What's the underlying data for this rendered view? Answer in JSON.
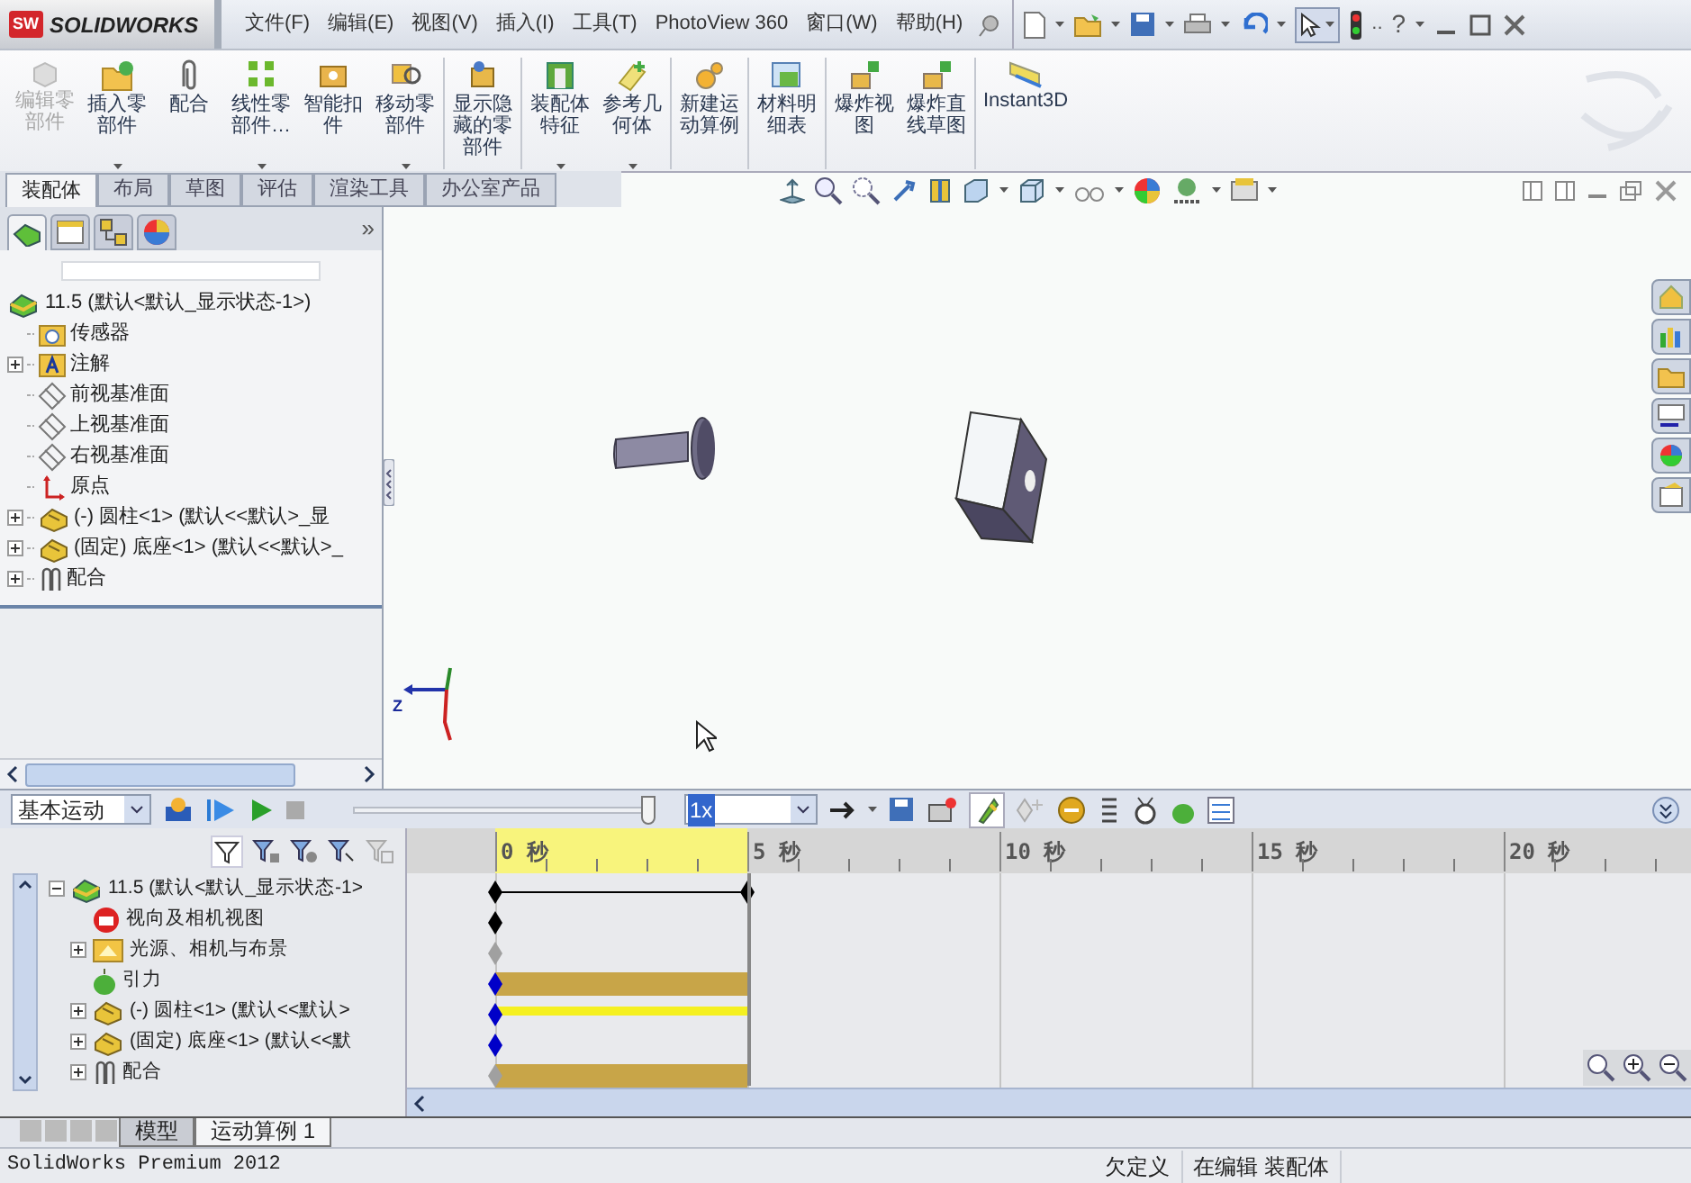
{
  "title_bar": {
    "logo_badge": "SW",
    "logo": "SOLIDWORKS",
    "menu": [
      "文件(F)",
      "编辑(E)",
      "视图(V)",
      "插入(I)",
      "工具(T)",
      "PhotoView 360",
      "窗口(W)",
      "帮助(H)"
    ],
    "more_glyph": "..",
    "help_glyph": "?"
  },
  "ribbon": {
    "commands": [
      {
        "label": "编辑零部件",
        "kind": "edit",
        "disabled": true,
        "dropdown": false,
        "separator_before": false
      },
      {
        "label": "插入零部件",
        "kind": "insert",
        "disabled": false,
        "dropdown": true,
        "separator_before": false
      },
      {
        "label": "配合",
        "kind": "mate",
        "disabled": false,
        "dropdown": false,
        "separator_before": false
      },
      {
        "label": "线性零部件…",
        "kind": "pattern",
        "disabled": false,
        "dropdown": true,
        "separator_before": false
      },
      {
        "label": "智能扣件",
        "kind": "fastener",
        "disabled": false,
        "dropdown": false,
        "separator_before": false
      },
      {
        "label": "移动零部件",
        "kind": "move",
        "disabled": false,
        "dropdown": true,
        "separator_before": false
      },
      {
        "label": "显示隐藏的零部件",
        "kind": "show",
        "disabled": false,
        "dropdown": false,
        "separator_before": true
      },
      {
        "label": "装配体特征",
        "kind": "feature",
        "disabled": false,
        "dropdown": true,
        "separator_before": true
      },
      {
        "label": "参考几何体",
        "kind": "reference",
        "disabled": false,
        "dropdown": true,
        "separator_before": false
      },
      {
        "label": "新建运动算例",
        "kind": "motion",
        "disabled": false,
        "dropdown": false,
        "separator_before": true
      },
      {
        "label": "材料明细表",
        "kind": "bom",
        "disabled": false,
        "dropdown": false,
        "separator_before": true
      },
      {
        "label": "爆炸视图",
        "kind": "explode",
        "disabled": false,
        "dropdown": false,
        "separator_before": true
      },
      {
        "label": "爆炸直线草图",
        "kind": "explode",
        "disabled": false,
        "dropdown": false,
        "separator_before": false
      },
      {
        "label": "Instant3D",
        "kind": "instant3d",
        "disabled": false,
        "dropdown": false,
        "separator_before": true
      }
    ]
  },
  "command_tabs": [
    {
      "label": "装配体",
      "selected": true
    },
    {
      "label": "布局",
      "selected": false
    },
    {
      "label": "草图",
      "selected": false
    },
    {
      "label": "评估",
      "selected": false
    },
    {
      "label": "渲染工具",
      "selected": false
    },
    {
      "label": "办公室产品",
      "selected": false
    }
  ],
  "feature_tree": {
    "panel_tabs": [
      {
        "kind": "tree",
        "selected": true
      },
      {
        "kind": "property",
        "selected": false
      },
      {
        "kind": "config",
        "selected": false
      },
      {
        "kind": "display",
        "selected": false
      }
    ],
    "expand_glyph": "»",
    "root": {
      "label": "11.5 (默认<默认_显示状态-1>)",
      "children": [
        {
          "label": "传感器",
          "kind": "sensor",
          "expandable": false
        },
        {
          "label": "注解",
          "kind": "annotation",
          "expandable": true
        },
        {
          "label": "前视基准面",
          "kind": "plane",
          "expandable": false
        },
        {
          "label": "上视基准面",
          "kind": "plane",
          "expandable": false
        },
        {
          "label": "右视基准面",
          "kind": "plane",
          "expandable": false
        },
        {
          "label": "原点",
          "kind": "origin",
          "expandable": false
        },
        {
          "label": "(-) 圆柱<1> (默认<<默认>_显",
          "kind": "part",
          "expandable": true
        },
        {
          "label": "(固定) 底座<1> (默认<<默认>_",
          "kind": "part",
          "expandable": true
        },
        {
          "label": "配合",
          "kind": "mate",
          "expandable": true
        }
      ]
    }
  },
  "viewport": {
    "axis_label": "Z"
  },
  "motion": {
    "study_type": "基本运动",
    "playback_speed": "1x",
    "slider": {
      "level": 0.98
    },
    "ticks": [
      {
        "label": "0 秒",
        "highlighted": true
      },
      {
        "label": "5 秒",
        "highlighted": false
      },
      {
        "label": "10 秒",
        "highlighted": false
      },
      {
        "label": "15 秒",
        "highlighted": false
      },
      {
        "label": "20 秒",
        "highlighted": false
      }
    ],
    "rows": [
      {
        "label": "11.5 (默认<默认_显示状态-1>",
        "kind": "assembly",
        "expandable": true,
        "expanded": true,
        "track": {
          "kind": "span",
          "color": "#000000"
        }
      },
      {
        "label": "视向及相机视图",
        "kind": "camera",
        "expandable": false,
        "expanded": false,
        "track": {
          "kind": "key",
          "color": "#000000"
        }
      },
      {
        "label": "光源、相机与布景",
        "kind": "lights",
        "expandable": true,
        "expanded": false,
        "track": {
          "kind": "key",
          "color": "#a0a0a0"
        }
      },
      {
        "label": "引力",
        "kind": "gravity",
        "expandable": false,
        "expanded": false,
        "track": {
          "kind": "bar",
          "color": "#0000c8"
        }
      },
      {
        "label": "(-) 圆柱<1> (默认<<默认>",
        "kind": "part",
        "expandable": true,
        "expanded": false,
        "track": {
          "kind": "thin",
          "color": "#0000c8"
        }
      },
      {
        "label": "(固定) 底座<1> (默认<<默",
        "kind": "part",
        "expandable": true,
        "expanded": false,
        "track": {
          "kind": "key",
          "color": "#0000c8"
        }
      },
      {
        "label": "配合",
        "kind": "mate",
        "expandable": true,
        "expanded": false,
        "track": {
          "kind": "bar",
          "color": "#a0a0a0"
        }
      }
    ],
    "bottom_tabs": [
      {
        "label": "模型",
        "selected": false
      },
      {
        "label": "运动算例 1",
        "selected": true
      }
    ]
  },
  "status_bar": {
    "product": "SolidWorks Premium 2012",
    "fields": [
      "欠定义",
      "在编辑 装配体"
    ]
  }
}
